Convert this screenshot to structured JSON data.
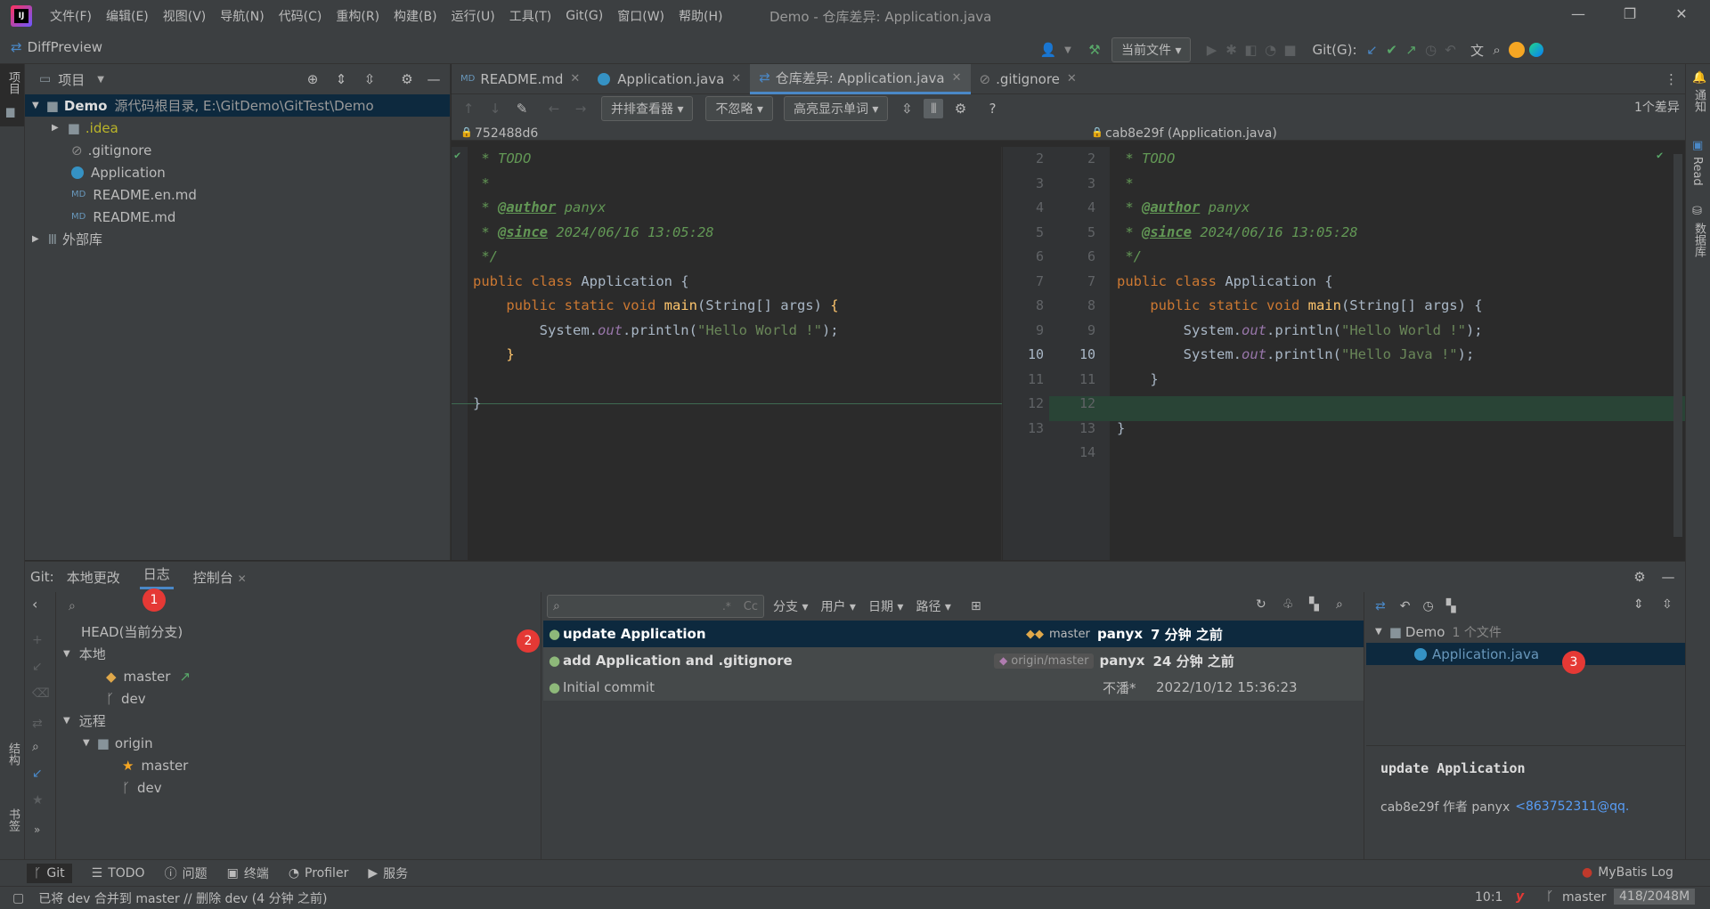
{
  "titlebar": {
    "logo": "IJ",
    "menu": [
      "文件(F)",
      "编辑(E)",
      "视图(V)",
      "导航(N)",
      "代码(C)",
      "重构(R)",
      "构建(B)",
      "运行(U)",
      "工具(T)",
      "Git(G)",
      "窗口(W)",
      "帮助(H)"
    ],
    "title": "Demo - 仓库差异: Application.java"
  },
  "navbar": {
    "breadcrumb": "DiffPreview",
    "run_config": "当前文件",
    "git_label": "Git(G):"
  },
  "left_stripe": {
    "project_label": "项目",
    "structure_label": "结构",
    "bookmarks_label": "书签"
  },
  "right_stripe": {
    "notifications_label": "通知",
    "read_label": "Read",
    "database_label": "数据库"
  },
  "project": {
    "header": "项目",
    "root_name": "Demo",
    "root_desc": "源代码根目录, E:\\GitDemo\\GitTest\\Demo",
    "items": [
      ".idea",
      ".gitignore",
      "Application",
      "README.en.md",
      "README.md"
    ],
    "external": "外部库"
  },
  "editor": {
    "tabs": [
      "README.md",
      "Application.java",
      "仓库差异: Application.java",
      ".gitignore"
    ],
    "viewer": "并排查看器",
    "ignore": "不忽略",
    "highlight": "高亮显示单词",
    "diff_count": "1个差异",
    "left_rev": "752488d6",
    "right_rev": "cab8e29f (Application.java)",
    "left_lines": [
      "2",
      "3",
      "4",
      "5",
      "6",
      "7",
      "8",
      "9",
      "10",
      "11",
      "12",
      "13"
    ],
    "right_lines": [
      "2",
      "3",
      "4",
      "5",
      "6",
      "7",
      "8",
      "9",
      "10",
      "11",
      "12",
      "13",
      "14"
    ]
  },
  "git": {
    "label": "Git:",
    "tabs": [
      "本地更改",
      "日志",
      "控制台"
    ],
    "head": "HEAD(当前分支)",
    "local": "本地",
    "local_branches": [
      "master",
      "dev"
    ],
    "remote": "远程",
    "origin": "origin",
    "remote_branches": [
      "master",
      "dev"
    ],
    "filters": [
      "分支",
      "用户",
      "日期",
      "路径"
    ],
    "search_regex": ".*",
    "search_case": "Cc",
    "commits": [
      {
        "msg": "update Application",
        "ref": "master",
        "author": "panyx",
        "date": "7 分钟 之前"
      },
      {
        "msg": "add Application and .gitignore",
        "ref": "origin/master",
        "author": "panyx",
        "date": "24 分钟 之前"
      },
      {
        "msg": "Initial commit",
        "ref": "",
        "author": "不潘*",
        "date": "2022/10/12 15:36:23"
      }
    ],
    "changes_root": "Demo",
    "changes_count": "1 个文件",
    "changed_file": "Application.java",
    "detail_title": "update Application",
    "detail_meta": "cab8e29f 作者 panyx",
    "detail_email": "<863752311@qq.",
    "badges": [
      "1",
      "2",
      "3"
    ]
  },
  "toolstrip": {
    "items": [
      "Git",
      "TODO",
      "问题",
      "终端",
      "Profiler",
      "服务"
    ],
    "mybatis": "MyBatis Log"
  },
  "status": {
    "message": "已将 dev 合并到 master // 删除 dev (4 分钟 之前)",
    "position": "10:1",
    "branch": "master",
    "memory": "418/2048M"
  },
  "colors": {
    "accent": "#4a88c7",
    "badge": "#e53935",
    "added_bg": "#294436",
    "selection": "#0d293e"
  }
}
